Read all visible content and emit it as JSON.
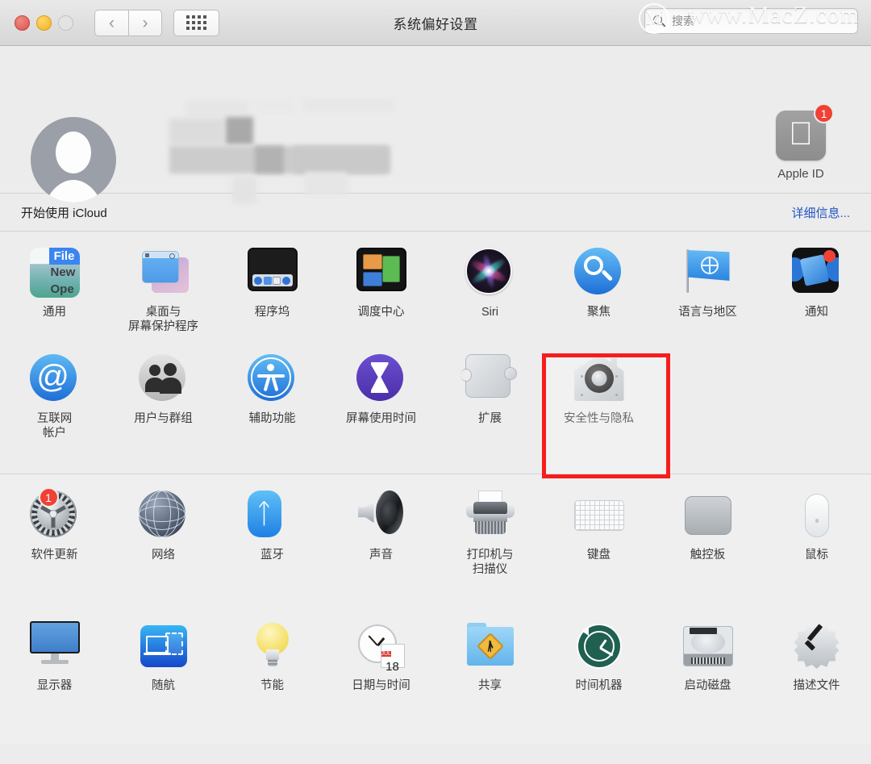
{
  "window": {
    "title": "系统偏好设置",
    "traffic_lights": [
      "close",
      "minimize",
      "zoom"
    ],
    "nav_back": "‹",
    "nav_forward": "›",
    "grid_button": "show-all-grid"
  },
  "search": {
    "placeholder": "搜索",
    "icon": "search-icon"
  },
  "watermark": {
    "logo": "M",
    "text": "www.MacZ.com"
  },
  "account": {
    "avatar": "default-user-avatar",
    "name_redacted": true,
    "apple_id": {
      "label": "Apple ID",
      "icon": "apple-logo-icon",
      "badge": "1"
    }
  },
  "icloud": {
    "text": "开始使用 iCloud",
    "link": "详细信息...",
    "link_color": "#2255c4"
  },
  "highlight": {
    "target": "安全性与隐私",
    "color": "#f71d1d"
  },
  "sections": [
    {
      "id": "section-top",
      "rows": [
        {
          "id": "row-1",
          "items": [
            {
              "label": "通用",
              "icon": "general-icon"
            },
            {
              "label": "桌面与\n屏幕保护程序",
              "label_line1": "桌面与",
              "label_line2": "屏幕保护程序",
              "icon": "desktop-screensaver-icon"
            },
            {
              "label": "程序坞",
              "icon": "dock-icon"
            },
            {
              "label": "调度中心",
              "icon": "mission-control-icon"
            },
            {
              "label": "Siri",
              "icon": "siri-icon"
            },
            {
              "label": "聚焦",
              "icon": "spotlight-icon"
            },
            {
              "label": "语言与地区",
              "icon": "language-region-icon"
            },
            {
              "label": "通知",
              "icon": "notifications-icon",
              "badge_dot": true
            }
          ]
        },
        {
          "id": "row-2",
          "items": [
            {
              "label": "互联网\n帐户",
              "label_line1": "互联网",
              "label_line2": "帐户",
              "icon": "internet-accounts-icon"
            },
            {
              "label": "用户与群组",
              "icon": "users-groups-icon"
            },
            {
              "label": "辅助功能",
              "icon": "accessibility-icon"
            },
            {
              "label": "屏幕使用时间",
              "icon": "screen-time-icon"
            },
            {
              "label": "扩展",
              "icon": "extensions-icon"
            },
            {
              "label": "安全性与隐私",
              "icon": "security-privacy-icon",
              "highlighted": true
            },
            {
              "label": "",
              "icon": ""
            },
            {
              "label": "",
              "icon": ""
            }
          ]
        }
      ]
    },
    {
      "id": "section-bottom",
      "rows": [
        {
          "id": "row-3",
          "items": [
            {
              "label": "软件更新",
              "icon": "software-update-icon",
              "badge": "1"
            },
            {
              "label": "网络",
              "icon": "network-icon"
            },
            {
              "label": "蓝牙",
              "icon": "bluetooth-icon"
            },
            {
              "label": "声音",
              "icon": "sound-icon"
            },
            {
              "label": "打印机与\n扫描仪",
              "label_line1": "打印机与",
              "label_line2": "扫描仪",
              "icon": "printers-scanners-icon"
            },
            {
              "label": "键盘",
              "icon": "keyboard-icon"
            },
            {
              "label": "触控板",
              "icon": "trackpad-icon"
            },
            {
              "label": "鼠标",
              "icon": "mouse-icon"
            }
          ]
        },
        {
          "id": "row-4",
          "items": [
            {
              "label": "显示器",
              "icon": "displays-icon"
            },
            {
              "label": "随航",
              "icon": "sidecar-icon"
            },
            {
              "label": "节能",
              "icon": "energy-saver-icon"
            },
            {
              "label": "日期与时间",
              "icon": "date-time-icon",
              "cal_month": "JUL",
              "cal_day": "18"
            },
            {
              "label": "共享",
              "icon": "sharing-icon"
            },
            {
              "label": "时间机器",
              "icon": "time-machine-icon"
            },
            {
              "label": "启动磁盘",
              "icon": "startup-disk-icon"
            },
            {
              "label": "描述文件",
              "icon": "profiles-icon"
            }
          ]
        }
      ]
    }
  ]
}
